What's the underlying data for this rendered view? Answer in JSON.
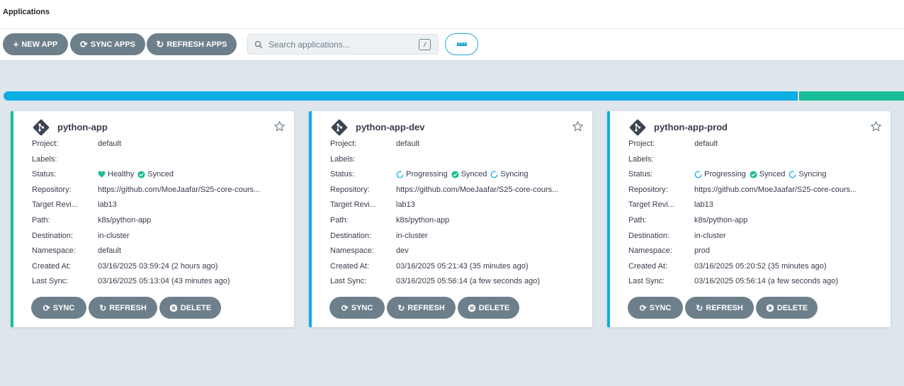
{
  "header": {
    "title": "Applications"
  },
  "toolbar": {
    "new_app": "NEW APP",
    "sync_apps": "SYNC APPS",
    "refresh_apps": "REFRESH APPS",
    "search_placeholder": "Search applications...",
    "search_shortcut": "/"
  },
  "status_summary": {
    "progressing_color": "#0dade6",
    "synced_color": "#18be94"
  },
  "labels": {
    "project": "Project:",
    "labels": "Labels:",
    "status": "Status:",
    "repository": "Repository:",
    "target_revision": "Target Revi...",
    "path": "Path:",
    "destination": "Destination:",
    "namespace": "Namespace:",
    "created_at": "Created At:",
    "last_sync": "Last Sync:",
    "sync": "SYNC",
    "refresh": "REFRESH",
    "delete": "DELETE"
  },
  "apps": [
    {
      "name": "python-app",
      "border_color": "#18be94",
      "project": "default",
      "labels": "",
      "health": "Healthy",
      "sync": "Synced",
      "operation": "",
      "repository": "https://github.com/MoeJaafar/S25-core-cours...",
      "target_revision": "lab13",
      "path": "k8s/python-app",
      "destination": "in-cluster",
      "namespace": "default",
      "created_at": "03/16/2025 03:59:24  (2 hours ago)",
      "last_sync": "03/16/2025 05:13:04  (43 minutes ago)"
    },
    {
      "name": "python-app-dev",
      "border_color": "#0dade6",
      "project": "default",
      "labels": "",
      "health": "Progressing",
      "sync": "Synced",
      "operation": "Syncing",
      "repository": "https://github.com/MoeJaafar/S25-core-cours...",
      "target_revision": "lab13",
      "path": "k8s/python-app",
      "destination": "in-cluster",
      "namespace": "dev",
      "created_at": "03/16/2025 05:21:43  (35 minutes ago)",
      "last_sync": "03/16/2025 05:56:14  (a few seconds ago)"
    },
    {
      "name": "python-app-prod",
      "border_color": "#0dade6",
      "project": "default",
      "labels": "",
      "health": "Progressing",
      "sync": "Synced",
      "operation": "Syncing",
      "repository": "https://github.com/MoeJaafar/S25-core-cours...",
      "target_revision": "lab13",
      "path": "k8s/python-app",
      "destination": "in-cluster",
      "namespace": "prod",
      "created_at": "03/16/2025 05:20:52  (35 minutes ago)",
      "last_sync": "03/16/2025 05:56:14  (a few seconds ago)"
    }
  ]
}
